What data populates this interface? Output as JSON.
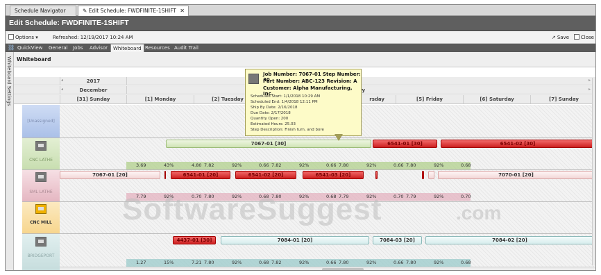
{
  "doc_tabs": [
    {
      "label": "Schedule Navigator"
    },
    {
      "label": "Edit Schedule: FWDFINITE-1SHIFT"
    }
  ],
  "page_title": "Edit Schedule: FWDFINITE-1SHIFT",
  "options": {
    "options_label": "Options",
    "refreshed": "Refreshed: 12/19/2017 10:24 AM",
    "save_label": "Save",
    "close_label": "Close"
  },
  "view_tabs": [
    "QuickView",
    "General",
    "Jobs",
    "Advisor",
    "Whiteboard",
    "Resources",
    "Audit Trail"
  ],
  "active_view": "Whiteboard",
  "side_label": "Whiteboard Settings",
  "whiteboard_label": "Whiteboard",
  "calendar": {
    "year": "2017",
    "month": "December",
    "month2": "ry",
    "days": [
      "[31] Sunday",
      "[1] Monday",
      "[2] Tuesday",
      "rsday",
      "[5] Friday",
      "[6] Saturday",
      "[7] Sunday"
    ]
  },
  "resources": [
    {
      "name": "[Unassigned]"
    },
    {
      "name": "CNC LATHE"
    },
    {
      "name": "SML LATHE"
    },
    {
      "name": "CNC MILL"
    },
    {
      "name": "BRIDGEPORT"
    }
  ],
  "lathe_bars": [
    "7067-01 [30]",
    "6541-01 [30]",
    "6541-02 [30]"
  ],
  "lathe_stats": [
    "3.69",
    "43%",
    "4.80",
    "7.82",
    "92%",
    "0.66",
    "7.82",
    "92%",
    "0.66",
    "7.80",
    "92%",
    "0.66",
    "7.80",
    "92%",
    "0.68"
  ],
  "sml_bars": [
    "7067-01 [20]",
    "6541-01 [20]",
    "6541-02 [20]",
    "6541-03 [20]",
    "7070-01 [20]"
  ],
  "sml_stats": [
    "7.79",
    "92%",
    "0.70",
    "7.80",
    "92%",
    "0.68",
    "7.80",
    "92%",
    "0.68",
    "7.79",
    "92%",
    "0.70",
    "7.79",
    "92%",
    "0.70"
  ],
  "bridge_bars": [
    "4437-01 [30]",
    "7084-01 [20]",
    "7084-03 [20]",
    "7084-02 [20]"
  ],
  "bridge_stats": [
    "1.27",
    "15%",
    "7.21",
    "7.80",
    "92%",
    "0.68",
    "7.82",
    "92%",
    "0.66",
    "7.80",
    "92%",
    "0.66",
    "7.80",
    "92%",
    "0.68"
  ],
  "tooltip": {
    "line1": "Job Number: 7067-01 Step Number: 30",
    "line2": "Part Number: ABC-123 Revision: A",
    "line3": "Customer: Alpha Manufacturing, Inc.",
    "details": [
      "Scheduled Start: 1/1/2018 10:29 AM",
      "Scheduled End: 1/4/2018 12:11 PM",
      "Ship By Date: 2/16/2018",
      "Due Date: 2/17/2018",
      "Quantity Open: 200",
      "Estimated Hours: 25.03",
      "Step Description: Finish turn, and bore"
    ]
  },
  "watermark": "SoftwareSuggest",
  "watermark_suffix": ".com",
  "colors": {
    "late_job": "#cc1f1f",
    "titlebar": "#5f5f5f"
  }
}
